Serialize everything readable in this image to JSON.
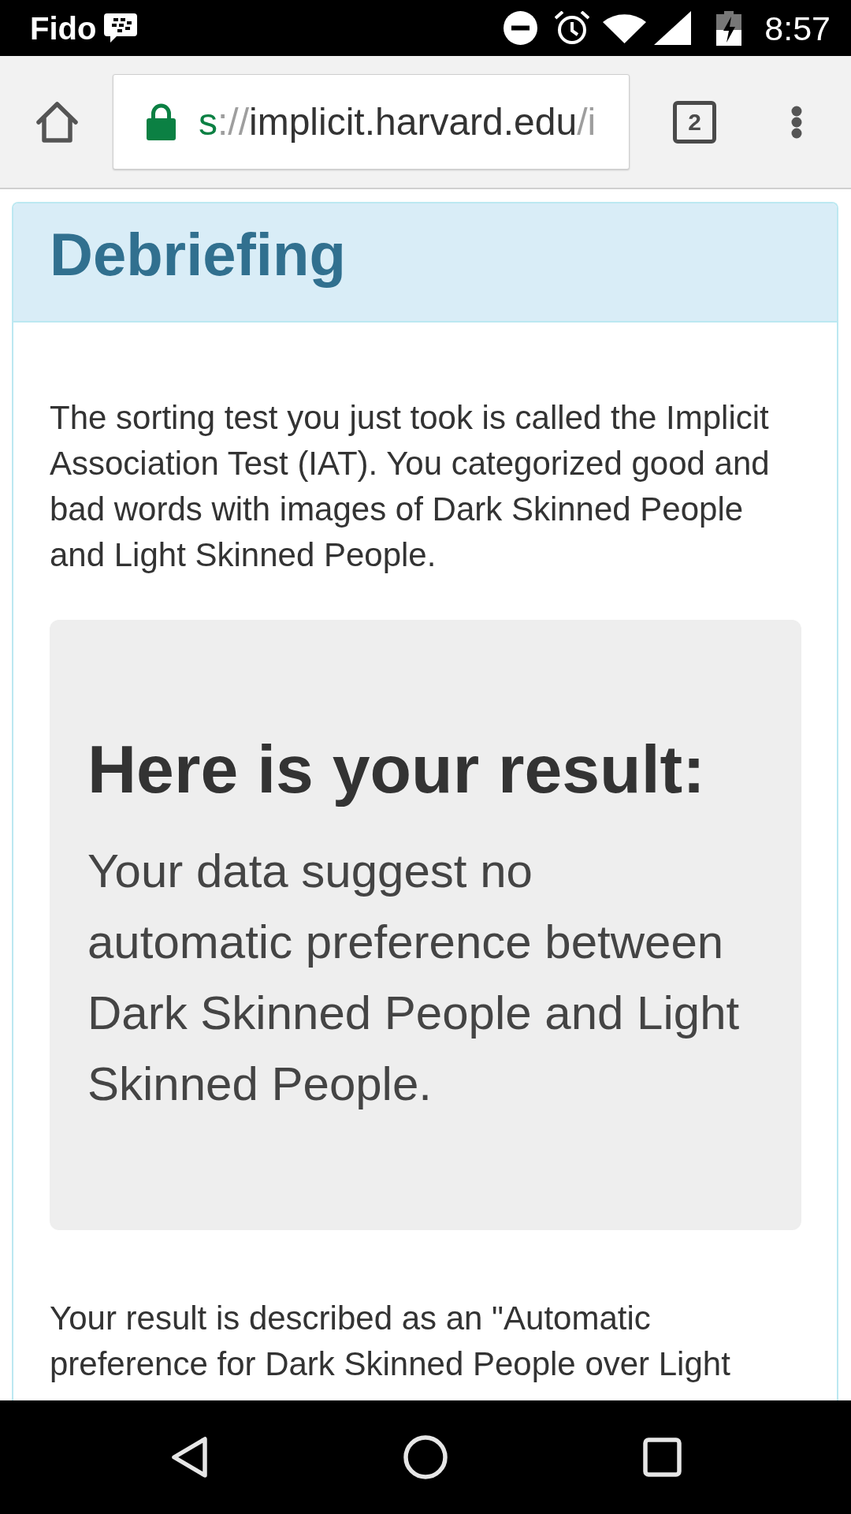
{
  "status_bar": {
    "carrier": "Fido",
    "time": "8:57"
  },
  "browser_toolbar": {
    "address": {
      "scheme": "s",
      "separator": "://",
      "host": "implicit.harvard.edu",
      "path": "/i"
    },
    "tab_count": "2"
  },
  "panel": {
    "title": "Debriefing",
    "intro": "The sorting test you just took is called the Implicit Association Test (IAT). You categorized good and bad words with images of Dark Skinned People and Light Skinned People.",
    "result": {
      "heading": "Here is your result:",
      "text": "Your data suggest no automatic preference between Dark Skinned People and Light Skinned People."
    },
    "description": "Your result is described as an \"Automatic preference for Dark Skinned People over Light"
  }
}
